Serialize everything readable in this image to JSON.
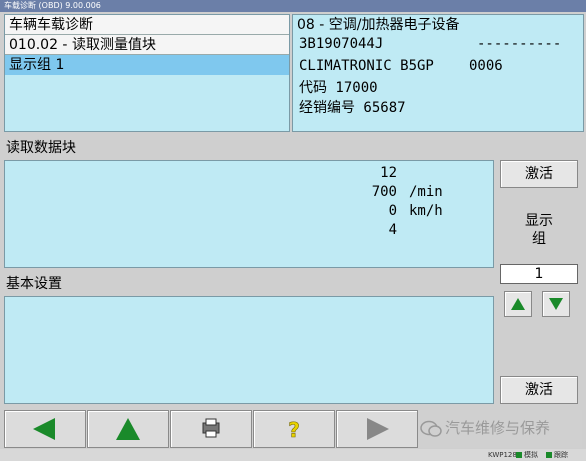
{
  "window": {
    "title": "车载诊断 (OBD) 9.00.006"
  },
  "left_panel": {
    "title": "车辆车载诊断",
    "function": "010.02 - 读取测量值块",
    "selected": "显示组 1"
  },
  "right_panel": {
    "system": "08 - 空调/加热器电子设备",
    "part_number": "3B1907044J",
    "dashes": "----------",
    "component": "CLIMATRONIC B5GP",
    "component_code": "0006",
    "code": "代码 17000",
    "dealer": "经销编号 65687"
  },
  "data_block": {
    "label": "读取数据块",
    "rows": [
      {
        "value": "12",
        "unit": ""
      },
      {
        "value": "700",
        "unit": "/min"
      },
      {
        "value": "0",
        "unit": "km/h"
      },
      {
        "value": "4",
        "unit": ""
      }
    ]
  },
  "basic_settings": {
    "label": "基本设置"
  },
  "side": {
    "activate_top": "激活",
    "display_group_label": "显示组",
    "group_value": "1",
    "activate_bottom": "激活"
  },
  "status": {
    "item1": "KWP1281",
    "item2": "模拟",
    "item3": "跟踪"
  },
  "watermark": "汽车维修与保养",
  "colors": {
    "panel": "#bfeaf4",
    "selected": "#7fc8ee",
    "arrow_green": "#1a8a2a",
    "help_yellow": "#e8d300"
  }
}
